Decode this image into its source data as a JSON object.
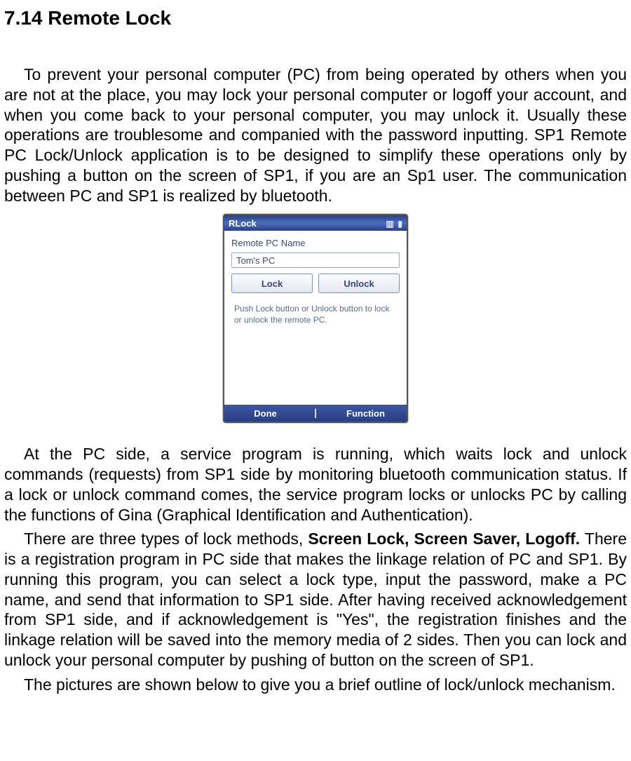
{
  "heading": "7.14 Remote Lock",
  "paragraph1": "To prevent your personal computer (PC) from being operated by others when you are not at the place, you may lock your personal computer or logoff your account, and when you come back to your personal computer, you may unlock it. Usually these operations are troublesome and companied with the password inputting. SP1 Remote PC Lock/Unlock application is to be designed to simplify these operations only by pushing a button on the screen of SP1, if you are an Sp1 user. The communication between PC and SP1 is realized by bluetooth.",
  "device": {
    "title": "RLock",
    "status_icons": {
      "battery": "🔋",
      "signal": "📶"
    },
    "body": {
      "label": "Remote PC Name",
      "pc_name": "Tom's PC",
      "buttons": {
        "lock": "Lock",
        "unlock": "Unlock"
      },
      "hint": "Push Lock button or Unlock button to lock or unlock the remote PC."
    },
    "footer": {
      "left": "Done",
      "right": "Function"
    }
  },
  "paragraph2": "At the PC side, a service program is running, which waits lock and unlock commands (requests) from SP1 side by monitoring bluetooth communication status. If a lock or unlock command comes, the service program locks or unlocks PC by calling the functions of Gina (Graphical Identification and Authentication).",
  "paragraph3a": "There are three types of lock methods, ",
  "paragraph3b_bold": "Screen Lock, Screen Saver, Logoff.",
  "paragraph3c": " There is a registration program in PC side that makes the linkage relation of PC and SP1. By running this program, you can select a lock type, input the password, make a PC name, and send that information to SP1 side. After having received acknowledgement from SP1 side, and if acknowledgement is \"Yes\", the registration finishes and the linkage relation will be saved into the memory media of 2 sides. Then you can lock and unlock your personal computer by pushing of button on the screen of SP1.",
  "paragraph4": "The pictures are shown below to give you a brief outline of lock/unlock mechanism."
}
